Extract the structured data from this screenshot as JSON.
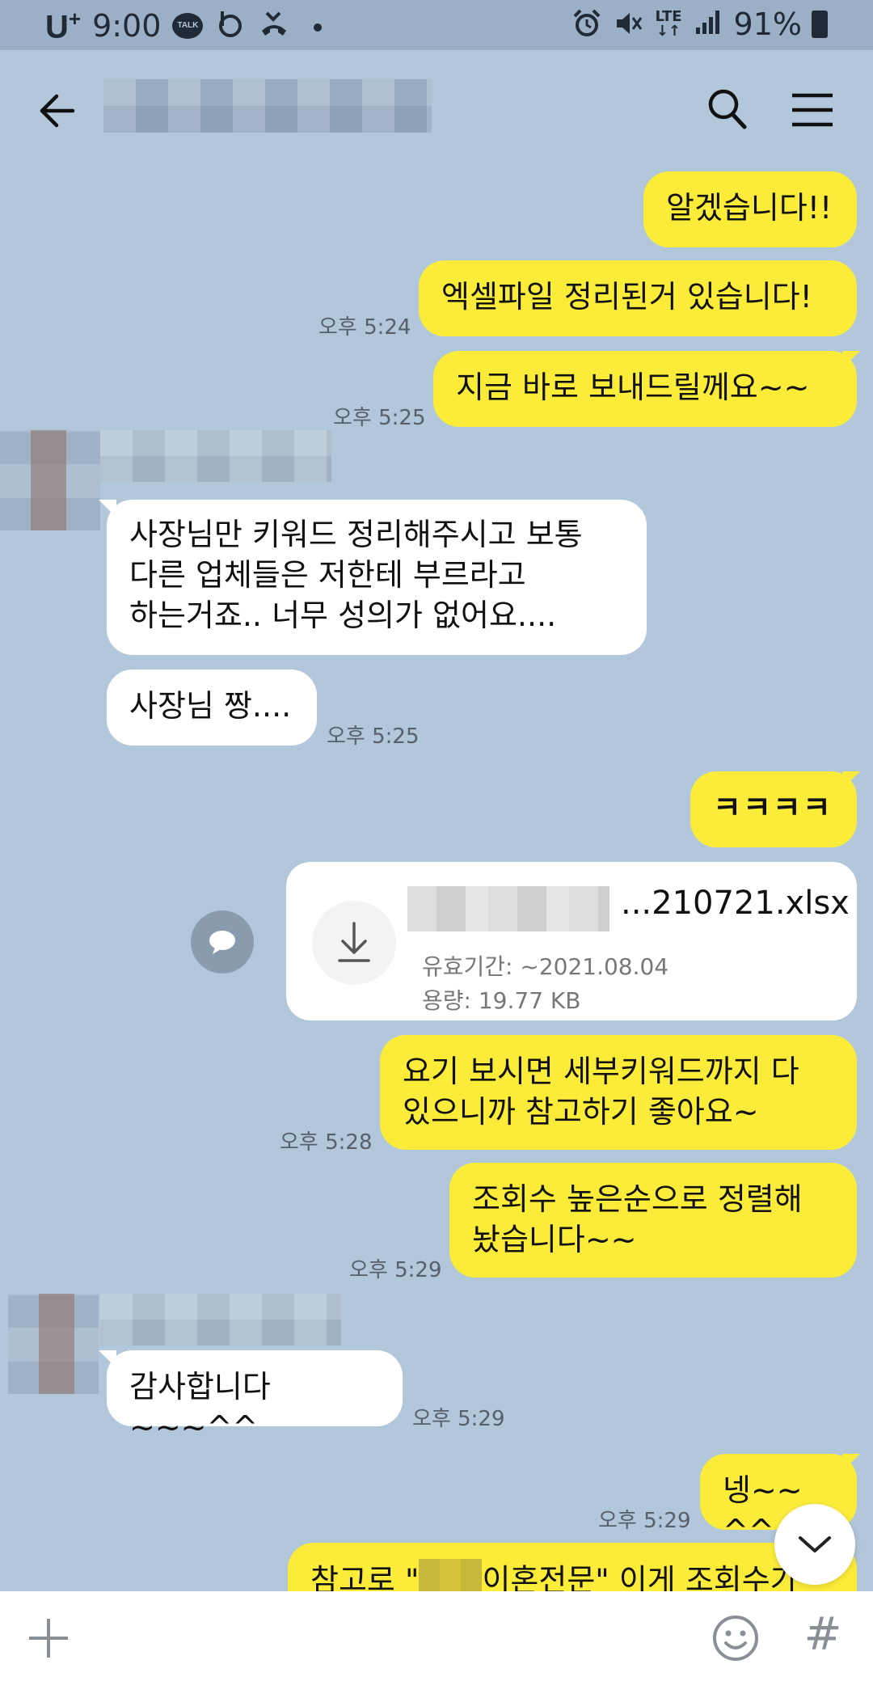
{
  "status_bar": {
    "carrier": "U",
    "carrier_sup": "+",
    "time": "9:00",
    "icons_left": [
      "talk-icon",
      "b-app-icon",
      "missed-call-icon",
      "dot-icon"
    ],
    "talk_text": "TALK",
    "network_top": "LTE",
    "network_bottom": "↓↑",
    "battery": "91%",
    "icons_right": [
      "alarm-icon",
      "mute-icon",
      "lte-icon",
      "signal-icon",
      "battery-icon"
    ]
  },
  "header": {
    "title": "",
    "icons": [
      "back-arrow-icon",
      "search-icon",
      "menu-icon"
    ]
  },
  "messages": [
    {
      "id": "m1",
      "from": "me",
      "text": "알겠습니다!!",
      "time": ""
    },
    {
      "id": "m2",
      "from": "me",
      "text": "엑셀파일 정리된거 있습니다!",
      "time": "오후 5:24"
    },
    {
      "id": "m3",
      "from": "me",
      "text": "지금 바로 보내드릴께요~~",
      "time": "오후 5:25"
    },
    {
      "id": "m4",
      "from": "other",
      "text": "사장님만 키워드 정리해주시고 보통\n다른 업체들은 저한테 부르라고\n하는거죠.. 너무 성의가 없어요....",
      "time": ""
    },
    {
      "id": "m5",
      "from": "other",
      "text": "사장님 짱....",
      "time": "오후 5:25"
    },
    {
      "id": "m6",
      "from": "me",
      "text": "ㅋㅋㅋㅋ",
      "time": ""
    },
    {
      "id": "m8",
      "from": "me",
      "text": "요기 보시면 세부키워드까지 다\n있으니까 참고하기 좋아요~",
      "time": "오후 5:28"
    },
    {
      "id": "m9",
      "from": "me",
      "text": "조회수 높은순으로 정렬해\n놨습니다~~",
      "time": "오후 5:29"
    },
    {
      "id": "m10",
      "from": "other",
      "text": "감사합니다~~~^^",
      "time": "오후 5:29"
    },
    {
      "id": "m11",
      "from": "me",
      "text": "넹~~ ^^",
      "time": "오후 5:29"
    },
    {
      "id": "m12",
      "from": "me",
      "text_before": "참고로 \"",
      "text_after": "이혼전문\" 이게 조회수가",
      "time": ""
    }
  ],
  "file": {
    "name_suffix": "...210721.xlsx",
    "expiry_label": "유효기간: ~2021.08.04",
    "size_label": "용량: 19.77 KB",
    "icons": [
      "download-icon",
      "share-bubble-icon"
    ]
  },
  "bottom_bar": {
    "icons": [
      "plus-icon",
      "emoji-icon",
      "hash-icon",
      "chevron-down-icon"
    ],
    "hash": "#"
  },
  "colors": {
    "background": "#b2c7da",
    "my_bubble": "#fcec3a",
    "their_bubble": "#ffffff",
    "status_bar": "#9bb0c6"
  }
}
